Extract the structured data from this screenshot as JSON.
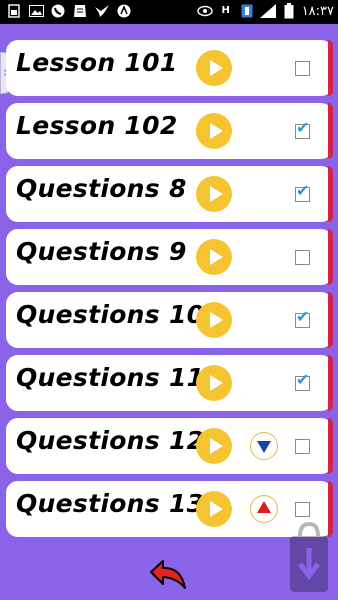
{
  "status_bar": {
    "time": "۱۸:۳۷",
    "left_icons": [
      "sim-icon",
      "gallery-icon",
      "call-icon",
      "mail-icon",
      "bird-icon",
      "nav-app-icon"
    ],
    "right_icons": [
      "eye-icon",
      "data-hplus-icon",
      "sim-indicator-icon",
      "signal-icon",
      "battery-icon"
    ],
    "data_label": "H"
  },
  "lessons": [
    {
      "title": "Lesson 101",
      "checked": false,
      "badge": ""
    },
    {
      "title": "Lesson 102",
      "checked": true,
      "badge": ""
    },
    {
      "title": "Questions 8",
      "checked": true,
      "badge": ""
    },
    {
      "title": "Questions 9",
      "checked": false,
      "badge": ""
    },
    {
      "title": "Questions 10",
      "checked": true,
      "badge": ""
    },
    {
      "title": "Questions 11",
      "checked": true,
      "badge": ""
    },
    {
      "title": "Questions 12",
      "checked": false,
      "badge": "down-arrow-icon"
    },
    {
      "title": "Questions 13",
      "checked": false,
      "badge": "up-arrow-icon"
    }
  ],
  "colors": {
    "background": "#8a63e8",
    "accent_strip": "#d6234a",
    "play_button": "#f6c430",
    "checkbox_tick": "#2a9bd8"
  },
  "footer": {
    "back_icon": "back-arrow-icon"
  }
}
